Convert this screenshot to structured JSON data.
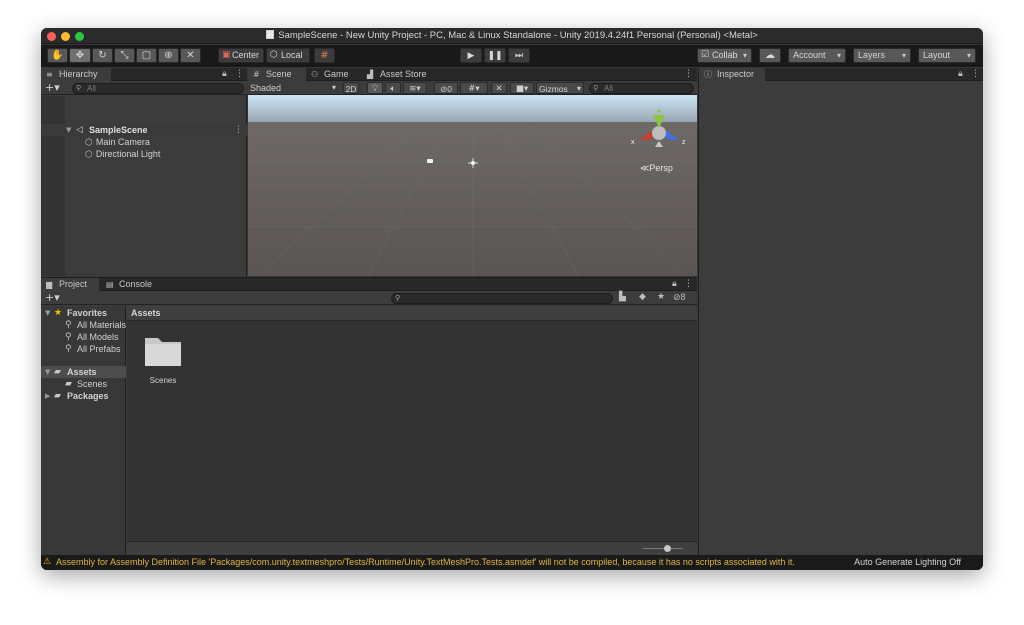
{
  "window": {
    "title": "SampleScene - New Unity Project - PC, Mac & Linux Standalone - Unity 2019.4.24f1 Personal (Personal) <Metal>"
  },
  "toolbar": {
    "tools": [
      "hand-tool",
      "move-tool",
      "rotate-tool",
      "scale-tool",
      "rect-tool",
      "transform-tool",
      "custom-tool"
    ],
    "pivot_label": "Center",
    "space_label": "Local",
    "collab_label": "Collab",
    "account_label": "Account",
    "layers_label": "Layers",
    "layout_label": "Layout"
  },
  "hierarchy": {
    "tab_label": "Hierarchy",
    "search_placeholder": "All",
    "scene_name": "SampleScene",
    "items": [
      {
        "label": "Main Camera"
      },
      {
        "label": "Directional Light"
      }
    ]
  },
  "scene_view": {
    "tabs": [
      {
        "label": "Scene"
      },
      {
        "label": "Game"
      },
      {
        "label": "Asset Store"
      }
    ],
    "shading_mode": "Shaded",
    "mode_2d_label": "2D",
    "hidden_count": "0",
    "gizmos_label": "Gizmos",
    "search_placeholder": "All",
    "gizmo_x": "x",
    "gizmo_z": "z",
    "projection_label": "Persp"
  },
  "project": {
    "tabs": [
      {
        "label": "Project"
      },
      {
        "label": "Console"
      }
    ],
    "hidden_count": "8",
    "favorites_label": "Favorites",
    "favorites": [
      {
        "label": "All Materials"
      },
      {
        "label": "All Models"
      },
      {
        "label": "All Prefabs"
      }
    ],
    "assets_label": "Assets",
    "asset_children": [
      {
        "label": "Scenes"
      }
    ],
    "packages_label": "Packages",
    "breadcrumb": "Assets",
    "grid_items": [
      {
        "label": "Scenes"
      }
    ]
  },
  "inspector": {
    "tab_label": "Inspector"
  },
  "status_bar": {
    "message": "Assembly for Assembly Definition File 'Packages/com.unity.textmeshpro/Tests/Runtime/Unity.TextMeshPro.Tests.asmdef' will not be compiled, because it has no scripts associated with it.",
    "lighting_label": "Auto Generate Lighting Off"
  },
  "colors": {
    "warning": "#e0b640",
    "sky_top": "#cbe4f5",
    "ground": "#5d5856"
  }
}
